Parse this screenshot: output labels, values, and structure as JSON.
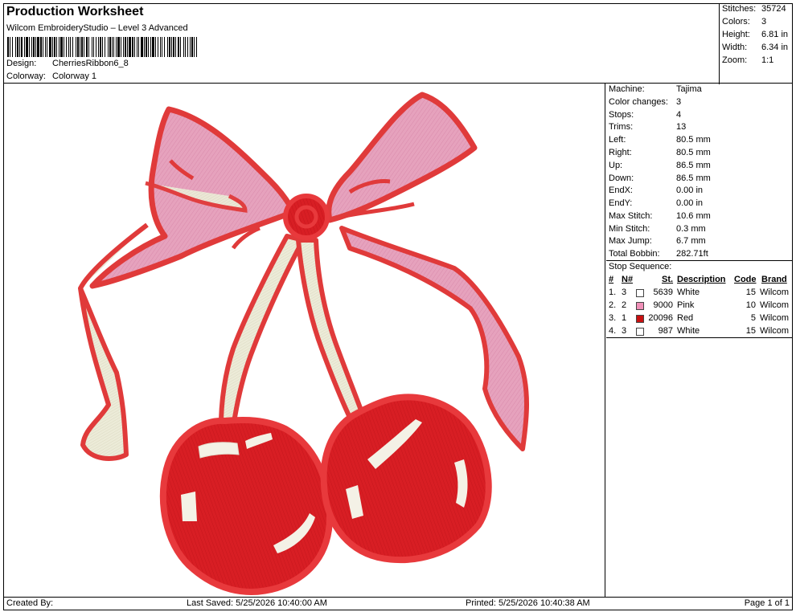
{
  "header": {
    "title": "Production Worksheet",
    "subtitle": "Wilcom EmbroideryStudio – Level 3 Advanced",
    "design_label": "Design:",
    "design_value": "CherriesRibbon6_8",
    "colorway_label": "Colorway:",
    "colorway_value": "Colorway 1"
  },
  "stats": [
    {
      "label": "Stitches:",
      "value": "35724"
    },
    {
      "label": "Colors:",
      "value": "3"
    },
    {
      "label": "Height:",
      "value": "6.81 in"
    },
    {
      "label": "Width:",
      "value": "6.34 in"
    },
    {
      "label": "Zoom:",
      "value": "1:1"
    }
  ],
  "machine_info": [
    {
      "label": "Machine:",
      "value": "Tajima"
    },
    {
      "label": "Color changes:",
      "value": "3"
    },
    {
      "label": "Stops:",
      "value": "4"
    },
    {
      "label": "Trims:",
      "value": "13"
    },
    {
      "label": "Left:",
      "value": "80.5 mm"
    },
    {
      "label": "Right:",
      "value": "80.5 mm"
    },
    {
      "label": "Up:",
      "value": "86.5 mm"
    },
    {
      "label": "Down:",
      "value": "86.5 mm"
    },
    {
      "label": "EndX:",
      "value": "0.00 in"
    },
    {
      "label": "EndY:",
      "value": "0.00 in"
    },
    {
      "label": "Max Stitch:",
      "value": "10.6 mm"
    },
    {
      "label": "Min Stitch:",
      "value": "0.3 mm"
    },
    {
      "label": "Max Jump:",
      "value": "6.7 mm"
    },
    {
      "label": "Total Bobbin:",
      "value": "282.71ft"
    }
  ],
  "stop_sequence": {
    "title": "Stop Sequence:",
    "headers": {
      "num": "#",
      "n": "N#",
      "st": "St.",
      "desc": "Description",
      "code": "Code",
      "brand": "Brand"
    },
    "rows": [
      {
        "num": "1.",
        "n": "3",
        "color": "#ffffff",
        "st": "5639",
        "desc": "White",
        "code": "15",
        "brand": "Wilcom"
      },
      {
        "num": "2.",
        "n": "2",
        "color": "#f090b8",
        "st": "9000",
        "desc": "Pink",
        "code": "10",
        "brand": "Wilcom"
      },
      {
        "num": "3.",
        "n": "1",
        "color": "#c81010",
        "st": "20096",
        "desc": "Red",
        "code": "5",
        "brand": "Wilcom"
      },
      {
        "num": "4.",
        "n": "3",
        "color": "#ffffff",
        "st": "987",
        "desc": "White",
        "code": "15",
        "brand": "Wilcom"
      }
    ]
  },
  "footer": {
    "created_by": "Created By:",
    "last_saved": "Last Saved: 5/25/2026 10:40:00 AM",
    "printed": "Printed: 5/25/2026 10:40:38 AM",
    "page": "Page 1 of 1"
  },
  "colors": {
    "ribbon_pink": "#e8a7c0",
    "ribbon_outline": "#e03a3a",
    "cherry_red": "#d81e24",
    "cherry_outline": "#e8393c",
    "stem_cream": "#ecebd8",
    "highlight": "#f4f1e6"
  }
}
